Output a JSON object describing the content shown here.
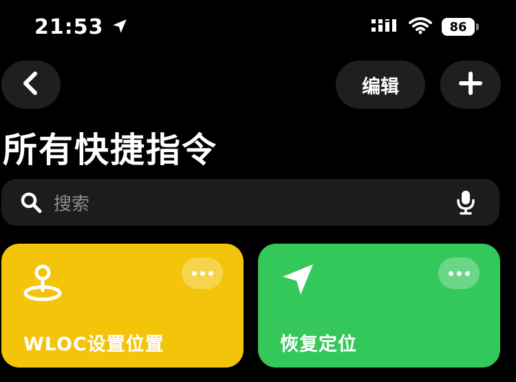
{
  "status_bar": {
    "time": "21:53",
    "battery": "86"
  },
  "nav": {
    "back_icon": "chevron-left-icon",
    "edit_label": "编辑",
    "add_icon": "plus-icon"
  },
  "page": {
    "title": "所有快捷指令"
  },
  "search": {
    "placeholder": "搜索"
  },
  "shortcuts": [
    {
      "label": "WLOC设置位置",
      "color": "#f4c40a",
      "icon": "location-pin-icon"
    },
    {
      "label": "恢复定位",
      "color": "#34c759",
      "icon": "location-arrow-icon"
    }
  ]
}
